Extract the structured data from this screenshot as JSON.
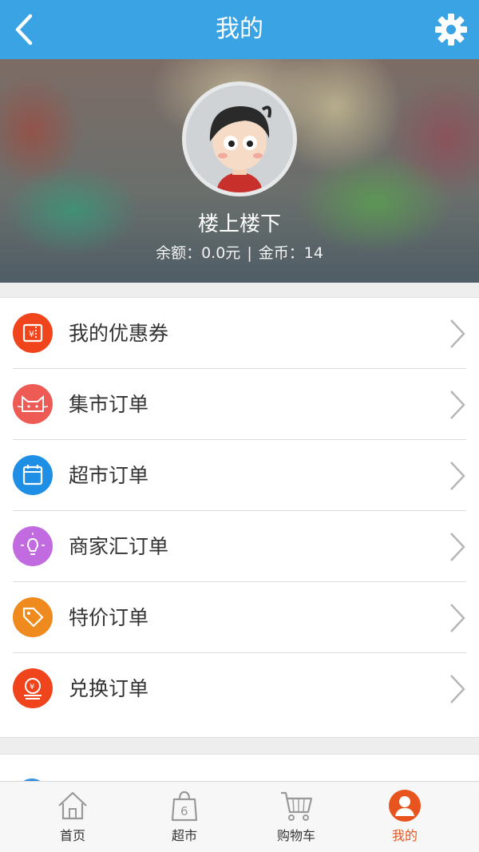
{
  "header": {
    "title": "我的",
    "back_icon": "back-arrow-icon",
    "settings_icon": "gear-icon"
  },
  "profile": {
    "username": "楼上楼下",
    "balance_label": "余额：",
    "balance_value": "0.0元",
    "separator": "|",
    "coins_label": "金币：",
    "coins_value": "14"
  },
  "menu": {
    "items": [
      {
        "label": "我的优惠券",
        "icon": "coupon-icon",
        "color": "#f0441c"
      },
      {
        "label": "集市订单",
        "icon": "cat-face-icon",
        "color": "#ee5b55"
      },
      {
        "label": "超市订单",
        "icon": "calendar-icon",
        "color": "#1f8fe6"
      },
      {
        "label": "商家汇订单",
        "icon": "lightbulb-icon",
        "color": "#c26be0"
      },
      {
        "label": "特价订单",
        "icon": "price-tag-icon",
        "color": "#ee8a1e"
      },
      {
        "label": "兑换订单",
        "icon": "coin-stack-icon",
        "color": "#f0441c"
      }
    ]
  },
  "tabbar": {
    "items": [
      {
        "label": "首页",
        "icon": "home-icon",
        "active": false
      },
      {
        "label": "超市",
        "icon": "shopping-bag-icon",
        "badge": "6",
        "active": false
      },
      {
        "label": "购物车",
        "icon": "cart-icon",
        "active": false
      },
      {
        "label": "我的",
        "icon": "user-icon",
        "active": true
      }
    ],
    "active_color": "#e8541e"
  },
  "colors": {
    "primary": "#3aa3e3"
  }
}
